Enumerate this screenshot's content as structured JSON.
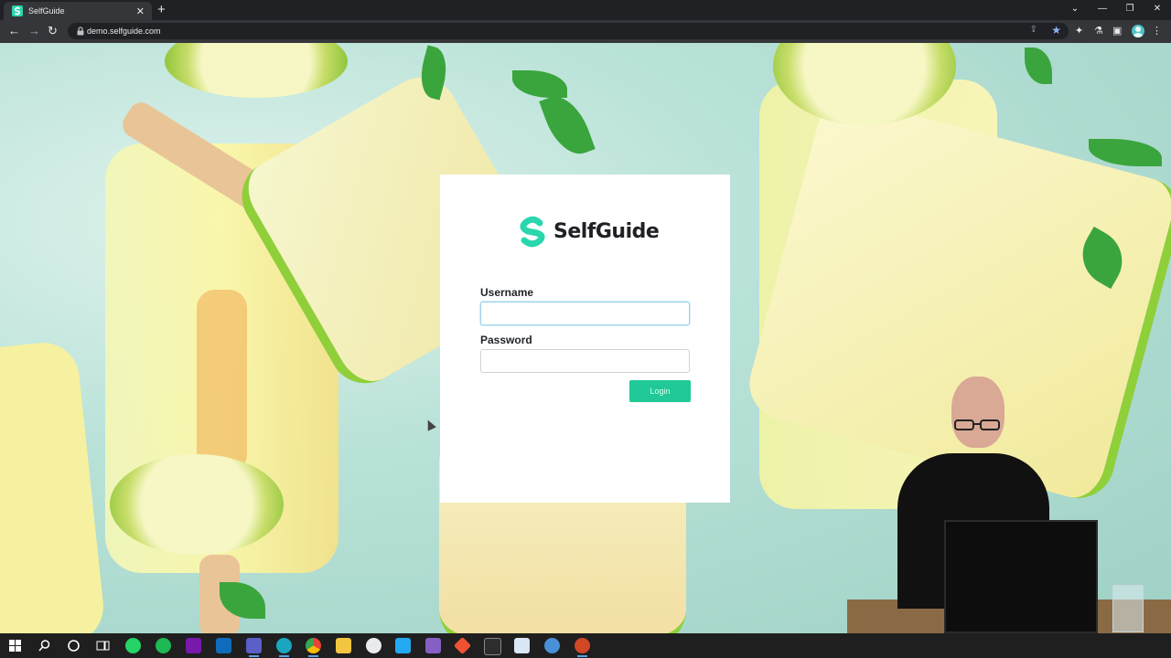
{
  "browser": {
    "tab_title": "SelfGuide",
    "tab_close": "✕",
    "new_tab": "+",
    "url": "demo.selfguide.com",
    "window_controls": [
      "⌄",
      "—",
      "❐",
      "✕"
    ]
  },
  "login": {
    "brand": "SelfGuide",
    "username_label": "Username",
    "username_value": "",
    "password_label": "Password",
    "password_value": "",
    "login_button": "Login"
  },
  "taskbar": {
    "icons": [
      "windows-start-icon",
      "search-icon",
      "cortana-icon",
      "task-view-icon",
      "whatsapp-icon",
      "spotify-icon",
      "onenote-icon",
      "outlook-icon",
      "teams-icon",
      "edge-icon",
      "chrome-icon",
      "file-explorer-icon",
      "vpn-icon",
      "vscode-icon",
      "visual-studio-icon",
      "git-icon",
      "terminal-icon",
      "calendar-icon",
      "globe-icon",
      "powerpoint-icon"
    ]
  },
  "colors": {
    "accent": "#20c997",
    "brand_teal": "#2ad6ad",
    "chrome_dark": "#202124",
    "chrome_toolbar": "#35363a"
  }
}
